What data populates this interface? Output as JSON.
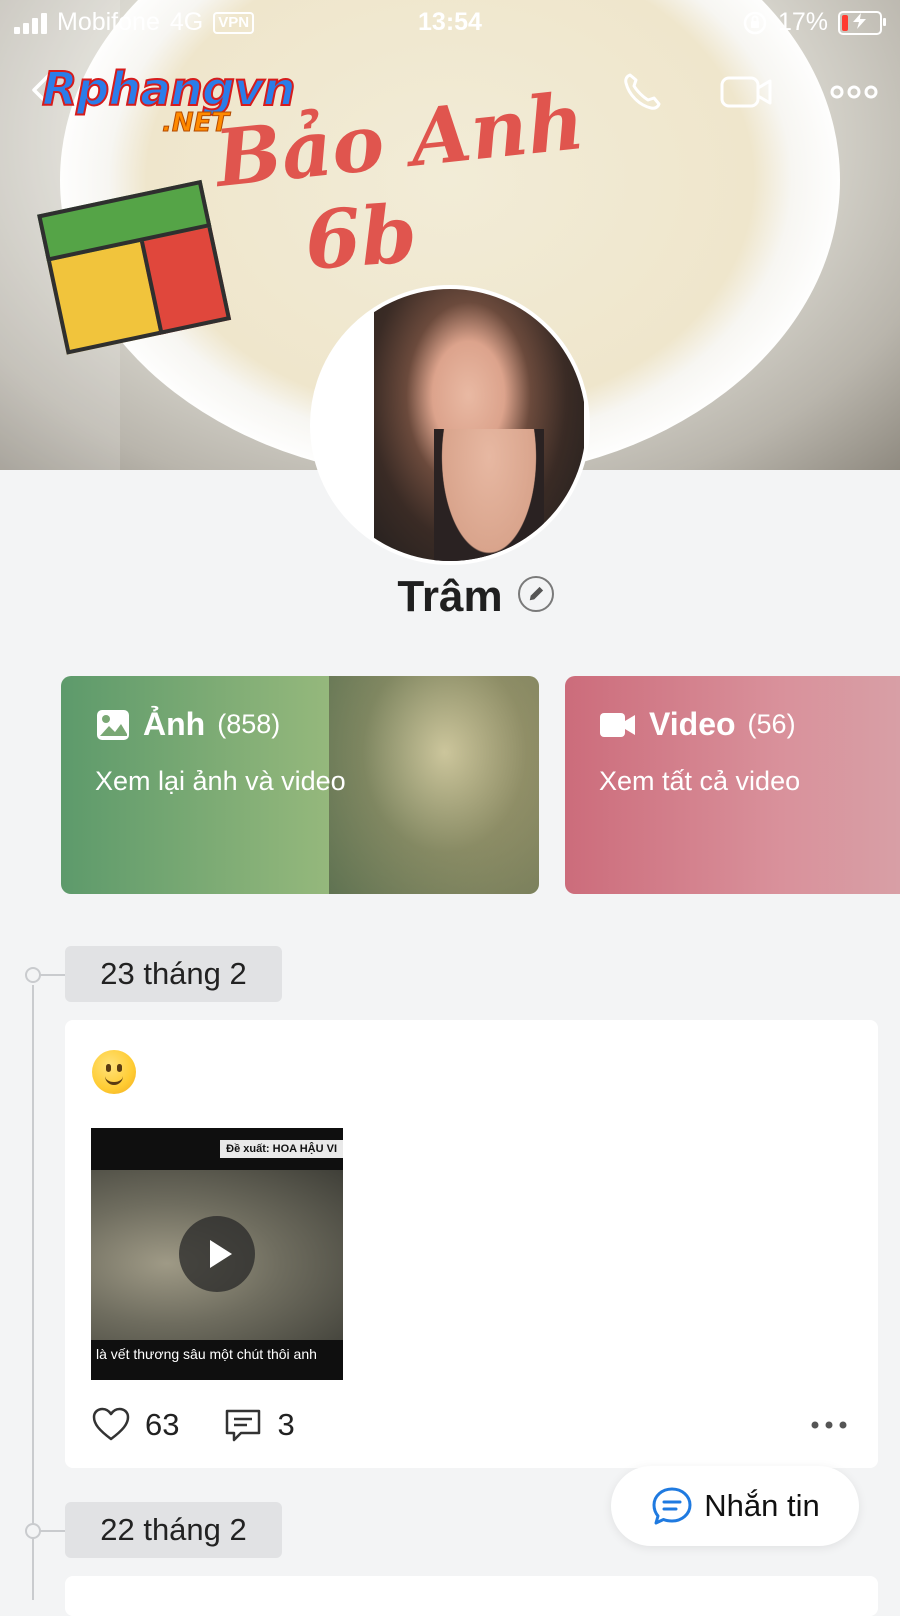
{
  "status_bar": {
    "carrier": "Mobifone",
    "network": "4G",
    "vpn_label": "VPN",
    "time": "13:54",
    "battery_percent": "17%",
    "battery_level": 0.17
  },
  "watermark": {
    "line1": "Rphangvn",
    "line2": ".NET"
  },
  "header": {
    "back_icon": "chevron-left-icon",
    "call_icon": "phone-icon",
    "video_call_icon": "video-camera-icon",
    "more_icon": "more-horizontal-icon"
  },
  "cover": {
    "cake_text_line1": "Bảo Anh",
    "cake_text_line2": "6b"
  },
  "profile": {
    "name": "Trâm",
    "edit_icon": "pencil-icon"
  },
  "media_cards": {
    "photos": {
      "title": "Ảnh",
      "count": "(858)",
      "subtitle": "Xem lại ảnh và video",
      "icon": "image-icon"
    },
    "videos": {
      "title": "Video",
      "count": "(56)",
      "subtitle": "Xem tất cả video",
      "icon": "video-icon"
    }
  },
  "timeline": [
    {
      "date": "23 tháng 2",
      "post": {
        "emoji": "slightly-smiling-face",
        "video_tag": "Đề xuất: HOA HẬU VI",
        "video_caption": "là vết thương sâu một chút thôi anh",
        "likes": "63",
        "comments": "3"
      }
    },
    {
      "date": "22 tháng 2"
    }
  ],
  "message_button": {
    "label": "Nhắn tin",
    "icon": "chat-bubble-icon"
  },
  "colors": {
    "accent_blue": "#1f7ae0",
    "photo_card": "#7aa874",
    "video_card": "#d27d89"
  }
}
